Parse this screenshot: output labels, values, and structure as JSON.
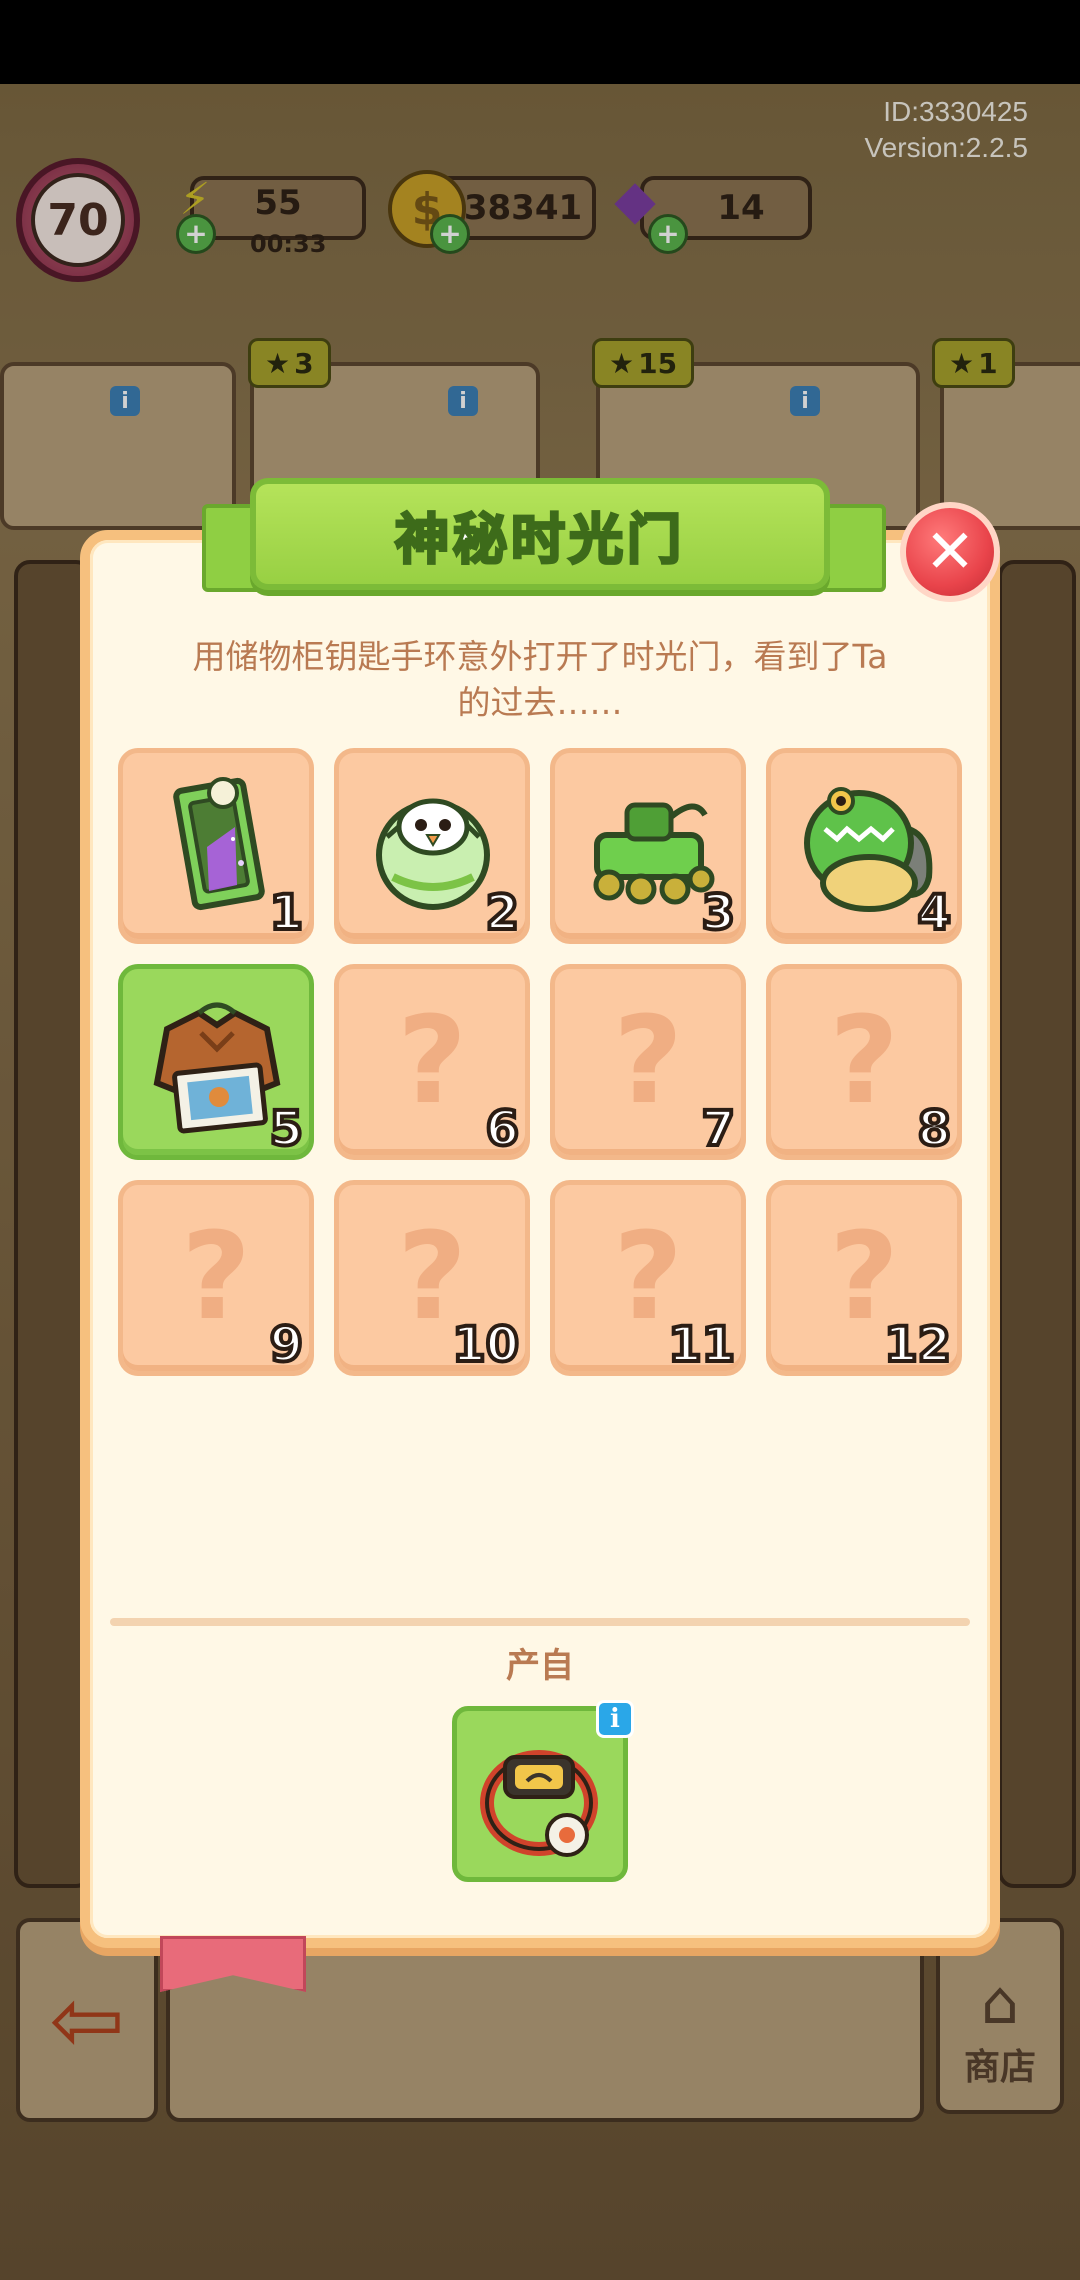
{
  "hud": {
    "player_id": "ID:3330425",
    "version": "Version:2.2.5",
    "level": "70",
    "energy": "55",
    "energy_timer": "00:33",
    "coins": "38341",
    "gems": "14"
  },
  "background_quests": [
    {
      "stars": "3"
    },
    {
      "stars": "15"
    },
    {
      "stars": "1"
    }
  ],
  "dialog": {
    "title": "神秘时光门",
    "description_line1": "用储物柜钥匙手环意外打开了时光门，看到了Ta",
    "description_line2": "的过去……",
    "source_label": "产自",
    "source_info": "i",
    "items": [
      {
        "num": "1",
        "icon": "mirror-wardrobe-icon",
        "unlocked": true
      },
      {
        "num": "2",
        "icon": "chick-egg-icon",
        "unlocked": true
      },
      {
        "num": "3",
        "icon": "toy-car-icon",
        "unlocked": true
      },
      {
        "num": "4",
        "icon": "dino-costume-icon",
        "unlocked": true
      },
      {
        "num": "5",
        "icon": "jacket-photo-icon",
        "unlocked": true,
        "selected": true
      },
      {
        "num": "6",
        "icon": "question-icon",
        "unlocked": false
      },
      {
        "num": "7",
        "icon": "question-icon",
        "unlocked": false
      },
      {
        "num": "8",
        "icon": "question-icon",
        "unlocked": false
      },
      {
        "num": "9",
        "icon": "question-icon",
        "unlocked": false
      },
      {
        "num": "10",
        "icon": "question-icon",
        "unlocked": false
      },
      {
        "num": "11",
        "icon": "question-icon",
        "unlocked": false
      },
      {
        "num": "12",
        "icon": "question-icon",
        "unlocked": false
      }
    ],
    "question_mark": "?"
  },
  "bottom": {
    "shop_label": "商店"
  },
  "colors": {
    "cell_bg": "#fcc9a1",
    "cell_selected": "#9ad85c",
    "title_ribbon": "#98d043",
    "close": "#e9444b"
  }
}
